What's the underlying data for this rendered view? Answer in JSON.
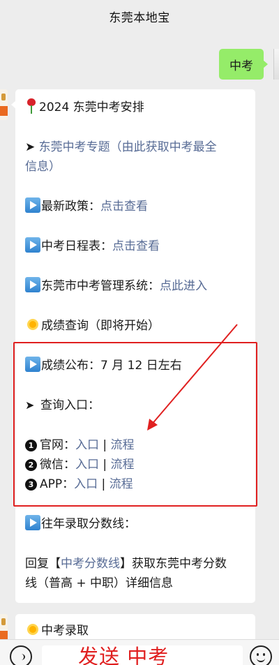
{
  "nav": {
    "title": "东莞本地宝"
  },
  "user_message": {
    "text": "中考"
  },
  "bot_message": {
    "heading": "2024 东莞中考安排",
    "topic_prefix": "➤ ",
    "topic_link_1": "东莞中考专题（由此获取中考最全",
    "topic_link_2": "信息）",
    "policy_label": "最新政策：",
    "policy_link": "点击查看",
    "schedule_label": "中考日程表：",
    "schedule_link": "点击查看",
    "system_label": "东莞市中考管理系统：",
    "system_link": "点此进入",
    "score_query": "成绩查询（即将开始）",
    "score_publish": "成绩公布：7 月 12 日左右",
    "query_entry": "查询入口：",
    "entries": [
      {
        "num": "1",
        "label": "官网：",
        "link1": "入口",
        "sep": " | ",
        "link2": "流程"
      },
      {
        "num": "2",
        "label": "微信：",
        "link1": "入口",
        "sep": " | ",
        "link2": "流程"
      },
      {
        "num": "3",
        "label": "APP：",
        "link1": "入口",
        "sep": " | ",
        "link2": "流程"
      }
    ],
    "past_scores": "往年录取分数线：",
    "reply_prefix": "回复【",
    "reply_keyword": "中考分数线",
    "reply_suffix": "】获取东莞中考分数",
    "reply_line2": "线（普高 + 中职）详细信息"
  },
  "bot_message_2": {
    "text": "中考录取"
  },
  "overlay": {
    "text": "发送 中考"
  },
  "annotation_color": "#e02020"
}
